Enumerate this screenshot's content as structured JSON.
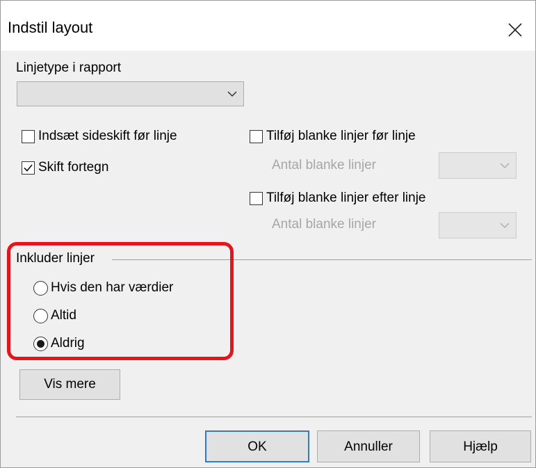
{
  "window": {
    "title": "Indstil layout",
    "close_icon": "close-icon"
  },
  "line_type": {
    "label": "Linjetype i rapport",
    "value": ""
  },
  "options": {
    "page_break": {
      "label": "Indsæt sideskift før linje",
      "checked": false
    },
    "change_sign": {
      "label": "Skift fortegn",
      "checked": true
    },
    "blank_before": {
      "label": "Tilføj blanke linjer før linje",
      "checked": false
    },
    "blank_before_count_label": "Antal blanke linjer",
    "blank_after": {
      "label": "Tilføj blanke linjer efter linje",
      "checked": false
    },
    "blank_after_count_label": "Antal blanke linjer"
  },
  "include_lines": {
    "group_label": "Inkluder linjer",
    "items": [
      {
        "label": "Hvis den har værdier",
        "selected": false
      },
      {
        "label": "Altid",
        "selected": false
      },
      {
        "label": "Aldrig",
        "selected": true
      }
    ],
    "highlight_color": "#e8141b"
  },
  "buttons": {
    "more": "Vis mere",
    "ok": "OK",
    "cancel": "Annuller",
    "help": "Hjælp"
  },
  "colors": {
    "dialog_bg": "#f0f0f0",
    "default_button_border": "#2f7ad6",
    "disabled_text": "#a6a6a6"
  }
}
